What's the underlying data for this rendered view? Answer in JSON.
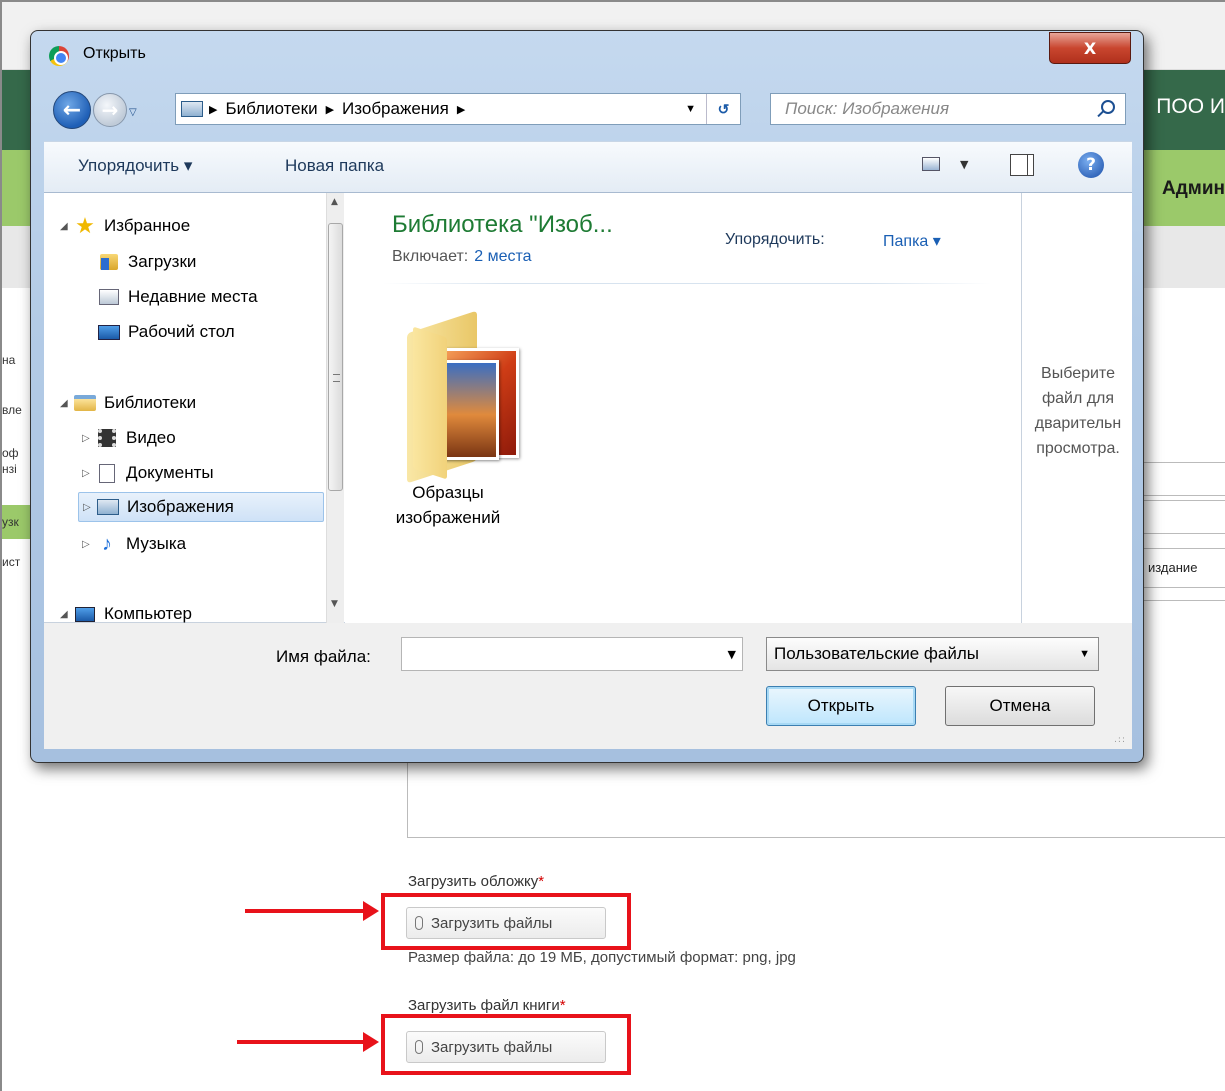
{
  "background": {
    "header_right_text": "ПОО И",
    "nav_right_text": "Админ",
    "side_labels": [
      "на",
      "вле",
      "оф",
      "нзі",
      "узк",
      "ист"
    ],
    "edition_text": "издание",
    "cover_label": "Загрузить обложку",
    "required_mark": "*",
    "upload_button": "Загрузить файлы",
    "file_hint": "Размер файла: до 19 МБ, допустимый формат: png, jpg",
    "book_label": "Загрузить файл книги",
    "annotation_color": "#e8121a"
  },
  "dialog": {
    "title": "Открыть",
    "close_label": "X",
    "breadcrumb": [
      "Библиотеки",
      "Изображения"
    ],
    "search_placeholder": "Поиск: Изображения",
    "toolbar": {
      "organize": "Упорядочить ▾",
      "new_folder": "Новая папка"
    },
    "tree": {
      "favorites": "Избранное",
      "downloads": "Загрузки",
      "recent": "Недавние места",
      "desktop": "Рабочий стол",
      "libraries": "Библиотеки",
      "video": "Видео",
      "documents": "Документы",
      "images": "Изображения",
      "music": "Музыка",
      "computer": "Компьютер"
    },
    "content": {
      "library_title": "Библиотека \"Изоб...",
      "includes_label": "Включает:",
      "includes_link": "2 места",
      "arrange_label": "Упорядочить:",
      "arrange_value": "Папка ▾",
      "folder_line1": "Образцы",
      "folder_line2": "изображений"
    },
    "preview": {
      "line1": "Выберите",
      "line2": "файл для",
      "line3": "дварительн",
      "line4": "просмотра."
    },
    "filename_label": "Имя файла:",
    "filename_value": "",
    "filetype_value": "Пользовательские файлы",
    "open_button": "Открыть",
    "cancel_button": "Отмена"
  }
}
